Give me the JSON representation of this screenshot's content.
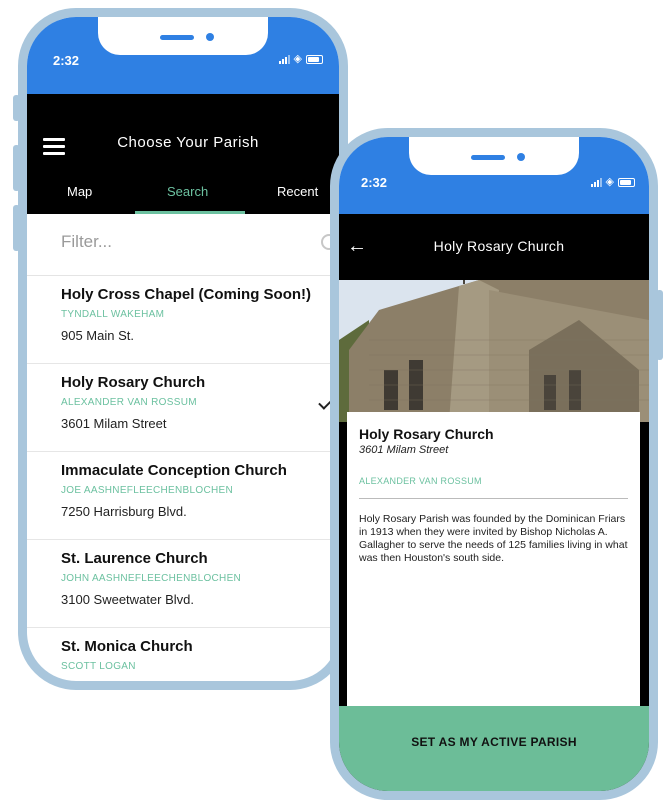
{
  "left_phone": {
    "status": {
      "time": "2:32"
    },
    "header": {
      "title": "Choose Your Parish"
    },
    "tabs": [
      {
        "label": "Map"
      },
      {
        "label": "Search",
        "active": true
      },
      {
        "label": "Recent"
      }
    ],
    "filter": {
      "placeholder": "Filter..."
    },
    "parishes": [
      {
        "name": "Holy Cross Chapel (Coming Soon!)",
        "pastor": "TYNDALL WAKEHAM",
        "address": "905 Main St.",
        "selected": false
      },
      {
        "name": "Holy Rosary Church",
        "pastor": "ALEXANDER VAN ROSSUM",
        "address": "3601 Milam Street",
        "selected": true
      },
      {
        "name": "Immaculate Conception Church",
        "pastor": "JOE AASHNEFLEECHENBLOCHEN",
        "address": "7250 Harrisburg Blvd.",
        "selected": false
      },
      {
        "name": "St. Laurence Church",
        "pastor": "JOHN AASHNEFLEECHENBLOCHEN",
        "address": "3100 Sweetwater Blvd.",
        "selected": false
      },
      {
        "name": "St. Monica Church",
        "pastor": "SCOTT LOGAN",
        "address": "",
        "selected": false
      }
    ]
  },
  "right_phone": {
    "status": {
      "time": "2:32"
    },
    "header": {
      "title": "Holy Rosary Church"
    },
    "card": {
      "name": "Holy Rosary Church",
      "address": "3601 Milam Street",
      "pastor": "ALEXANDER VAN ROSSUM",
      "description": "Holy Rosary Parish was founded by the Dominican Friars in 1913 when they were invited by Bishop Nicholas A. Gallagher to serve the needs of 125 families living in what was then Houston's south side."
    },
    "action": {
      "label": "SET AS MY ACTIVE PARISH"
    }
  },
  "colors": {
    "frame": "#a9c6dc",
    "status_bar": "#2f80e3",
    "accent": "#6cc1a0",
    "button": "#6cbd98"
  }
}
